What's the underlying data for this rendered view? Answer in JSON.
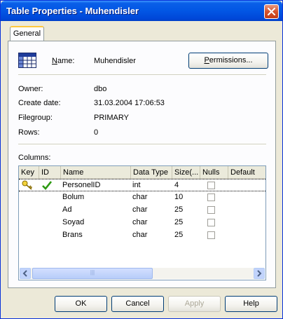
{
  "window": {
    "title": "Table Properties - Muhendisler"
  },
  "tabs": [
    {
      "label": "General"
    }
  ],
  "general": {
    "name_label": "Name:",
    "name_value": "Muhendisler",
    "permissions_label": "Permissions...",
    "permissions_mnemonic": "P",
    "owner_label": "Owner:",
    "owner_value": "dbo",
    "create_date_label": "Create date:",
    "create_date_value": "31.03.2004 17:06:53",
    "filegroup_label": "Filegroup:",
    "filegroup_value": "PRIMARY",
    "rows_label": "Rows:",
    "rows_value": "0",
    "columns_label": "Columns:"
  },
  "columns_grid": {
    "headers": [
      "Key",
      "ID",
      "Name",
      "Data Type",
      "Size(...",
      "Nulls",
      "Default"
    ],
    "rows": [
      {
        "key": true,
        "id": true,
        "name": "PersonelID",
        "type": "int",
        "size": "4",
        "nulls": false
      },
      {
        "key": false,
        "id": false,
        "name": "Bolum",
        "type": "char",
        "size": "10",
        "nulls": false
      },
      {
        "key": false,
        "id": false,
        "name": "Ad",
        "type": "char",
        "size": "25",
        "nulls": false
      },
      {
        "key": false,
        "id": false,
        "name": "Soyad",
        "type": "char",
        "size": "25",
        "nulls": false
      },
      {
        "key": false,
        "id": false,
        "name": "Brans",
        "type": "char",
        "size": "25",
        "nulls": false
      }
    ]
  },
  "footer": {
    "ok_label": "OK",
    "cancel_label": "Cancel",
    "apply_label": "Apply",
    "help_label": "Help"
  },
  "icons": {
    "table": "table-icon",
    "key": "key-icon",
    "identity": "checkmark-icon",
    "close": "close-icon"
  },
  "colors": {
    "title_bar": "#0256E4",
    "dialog_bg": "#ECE9D8",
    "tab_accent": "#FFC83C",
    "checkmark": "#2D9A12"
  }
}
